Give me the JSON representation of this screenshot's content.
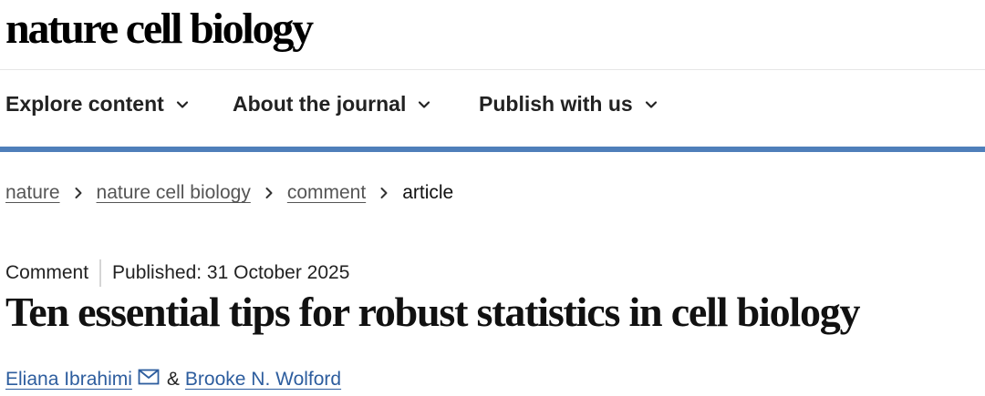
{
  "header": {
    "logo_text": "nature cell biology"
  },
  "nav": {
    "items": [
      {
        "label": "Explore content",
        "icon": "chevron-down-icon"
      },
      {
        "label": "About the journal",
        "icon": "chevron-down-icon"
      },
      {
        "label": "Publish with us",
        "icon": "chevron-down-icon"
      }
    ],
    "accent_color": "#4f7fba"
  },
  "breadcrumb": {
    "items": [
      {
        "label": "nature"
      },
      {
        "label": "nature cell biology"
      },
      {
        "label": "comment"
      },
      {
        "label": "article"
      }
    ],
    "separator_icon": "chevron-right-icon"
  },
  "article": {
    "type": "Comment",
    "published": "Published: 31 October 2025",
    "title": "Ten essential tips for robust statistics in cell biology",
    "authors": [
      {
        "name": "Eliana Ibrahimi",
        "icon": "mail-icon"
      },
      {
        "name": "Brooke N. Wolford"
      }
    ],
    "author_separator": "&",
    "link_color": "#2d5d9e"
  }
}
